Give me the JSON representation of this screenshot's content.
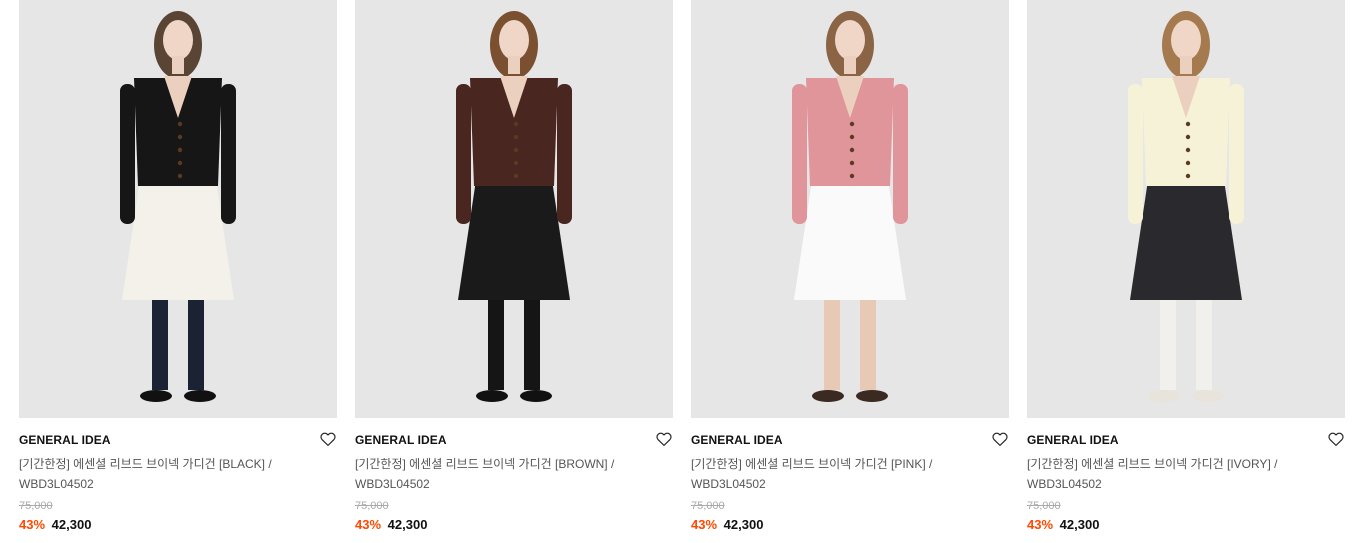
{
  "products": [
    {
      "brand": "GENERAL IDEA",
      "name_line1": "[기간한정] 에센셜 리브드 브이넥 가디건 [BLACK] /",
      "name_line2": "WBD3L04502",
      "original_price": "75,000",
      "discount": "43%",
      "sale_price": "42,300",
      "colors": {
        "top": "#161616",
        "bottom": "#f4f1ea",
        "legs": "#1b2233",
        "shoes": "#111111",
        "hair": "#5a4535"
      }
    },
    {
      "brand": "GENERAL IDEA",
      "name_line1": "[기간한정] 에센셜 리브드 브이넥 가디건 [BROWN] /",
      "name_line2": "WBD3L04502",
      "original_price": "75,000",
      "discount": "43%",
      "sale_price": "42,300",
      "colors": {
        "top": "#4a2620",
        "bottom": "#1a1a1a",
        "legs": "#151515",
        "shoes": "#111111",
        "hair": "#7a5030"
      }
    },
    {
      "brand": "GENERAL IDEA",
      "name_line1": "[기간한정] 에센셜 리브드 브이넥 가디건 [PINK] /",
      "name_line2": "WBD3L04502",
      "original_price": "75,000",
      "discount": "43%",
      "sale_price": "42,300",
      "colors": {
        "top": "#e0959a",
        "bottom": "#fafafa",
        "legs": "#e8c9b6",
        "shoes": "#3b2a22",
        "hair": "#8a6445"
      }
    },
    {
      "brand": "GENERAL IDEA",
      "name_line1": "[기간한정] 에센셜 리브드 브이넥 가디건 [IVORY] /",
      "name_line2": "WBD3L04502",
      "original_price": "75,000",
      "discount": "43%",
      "sale_price": "42,300",
      "colors": {
        "top": "#f6f2d8",
        "bottom": "#2a2a2e",
        "legs": "#f2f0ec",
        "shoes": "#e8e4dc",
        "hair": "#a47a4e"
      }
    }
  ]
}
